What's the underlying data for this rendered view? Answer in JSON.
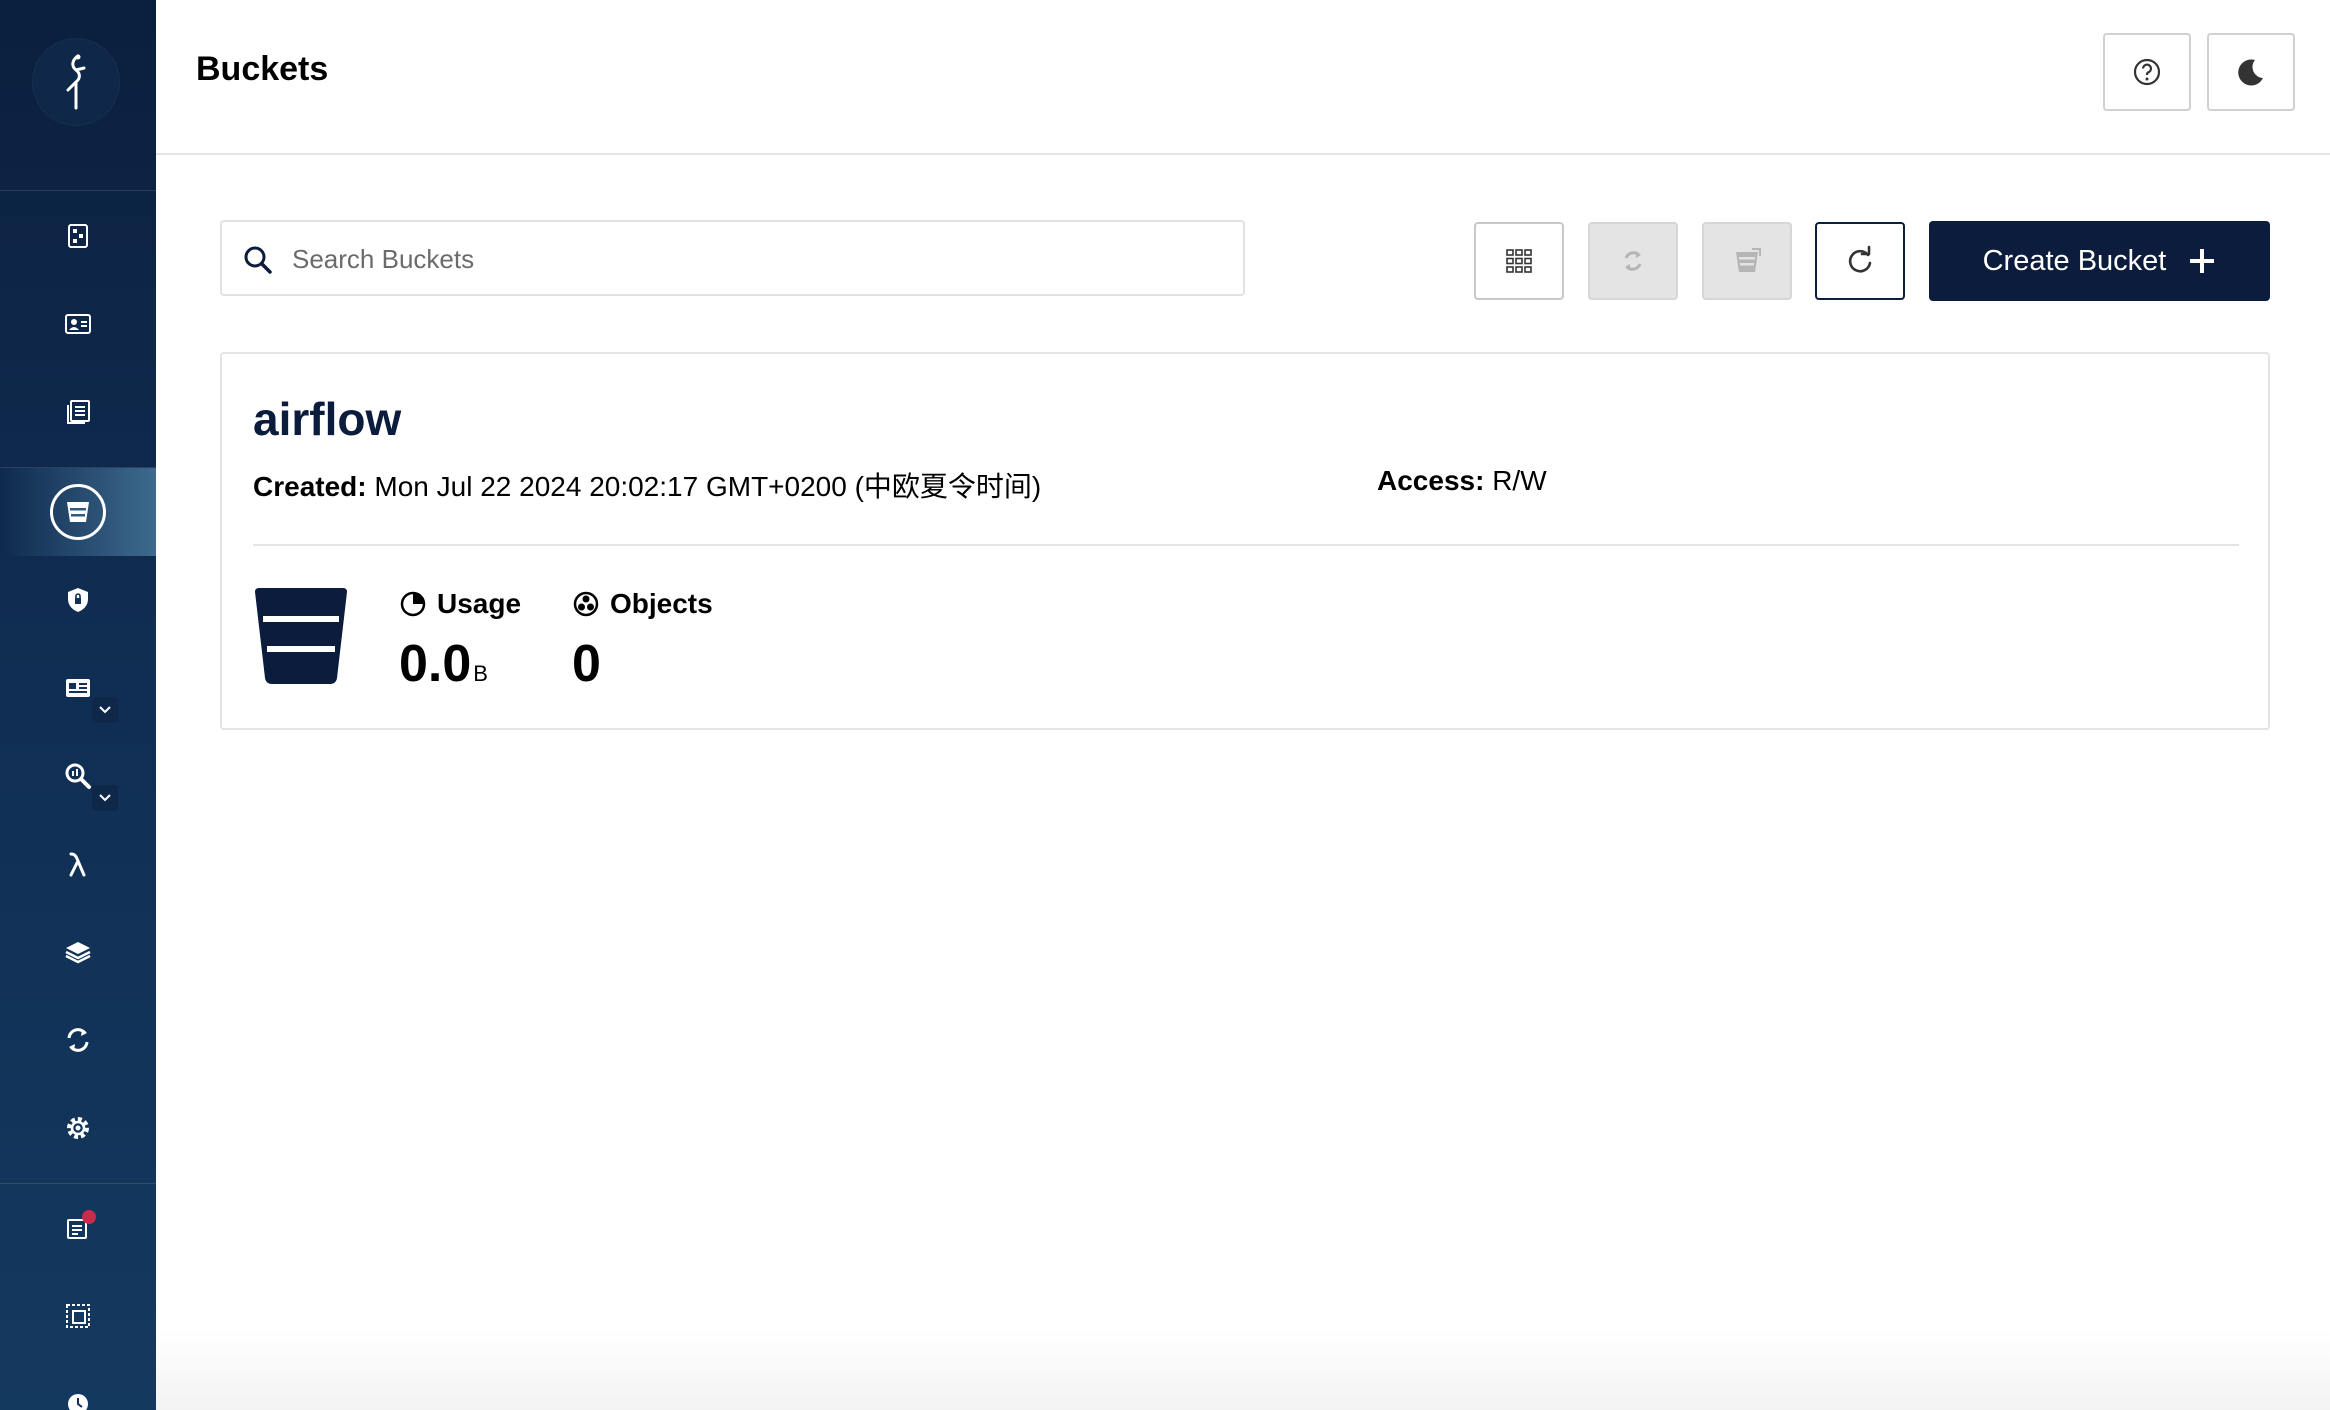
{
  "header": {
    "title": "Buckets",
    "help_icon": "help-circle-icon",
    "theme_icon": "moon-icon"
  },
  "sidebar": {
    "logo_icon": "minio-bird-logo",
    "items": [
      {
        "icon": "dashboard-icon"
      },
      {
        "icon": "identity-icon"
      },
      {
        "icon": "documents-icon"
      },
      {
        "icon": "bucket-icon",
        "active": true
      },
      {
        "icon": "shield-policy-icon"
      },
      {
        "icon": "id-card-icon",
        "expandable": true
      },
      {
        "icon": "monitoring-search-icon",
        "expandable": true
      },
      {
        "icon": "lambda-icon"
      },
      {
        "icon": "tiers-layers-icon"
      },
      {
        "icon": "replication-sync-icon"
      },
      {
        "icon": "settings-gear-icon"
      },
      {
        "icon": "license-icon",
        "badge": true
      },
      {
        "icon": "support-icon"
      },
      {
        "icon": "clock-icon"
      }
    ]
  },
  "search": {
    "placeholder": "Search Buckets",
    "value": ""
  },
  "toolbar": {
    "buttons": [
      {
        "icon": "grid-view-icon",
        "state": "enabled"
      },
      {
        "icon": "replication-icon",
        "state": "disabled"
      },
      {
        "icon": "lifecycle-icon",
        "state": "disabled"
      },
      {
        "icon": "refresh-icon",
        "state": "enabled"
      }
    ],
    "create_label": "Create Bucket"
  },
  "bucket": {
    "name": "airflow",
    "created_label": "Created:",
    "created_value": "Mon Jul 22 2024 20:02:17 GMT+0200 (中欧夏令时间)",
    "access_label": "Access:",
    "access_value": "R/W",
    "usage_label": "Usage",
    "usage_value": "0.0",
    "usage_unit": "B",
    "objects_label": "Objects",
    "objects_value": "0"
  },
  "colors": {
    "sidebar_dark": "#0b1f3e",
    "primary": "#0c1c3c",
    "badge_red": "#c72c48"
  }
}
